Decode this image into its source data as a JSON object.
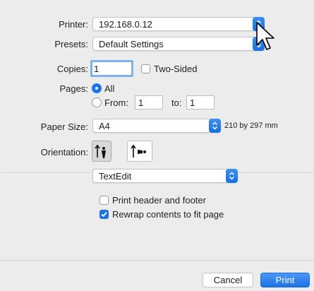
{
  "printer": {
    "label": "Printer:",
    "value": "192.168.0.12"
  },
  "presets": {
    "label": "Presets:",
    "value": "Default Settings"
  },
  "copies": {
    "label": "Copies:",
    "value": "1",
    "two_sided_label": "Two-Sided",
    "two_sided_checked": false
  },
  "pages": {
    "label": "Pages:",
    "all_label": "All",
    "from_label": "From:",
    "from_value": "1",
    "to_label": "to:",
    "to_value": "1",
    "selected": "All"
  },
  "paper_size": {
    "label": "Paper Size:",
    "value": "A4",
    "dimensions": "210 by 297 mm"
  },
  "orientation": {
    "label": "Orientation:",
    "selected": "portrait"
  },
  "app_section": {
    "value": "TextEdit"
  },
  "options": {
    "print_header_footer": {
      "label": "Print header and footer",
      "checked": false
    },
    "rewrap": {
      "label": "Rewrap contents to fit page",
      "checked": true
    }
  },
  "buttons": {
    "cancel": "Cancel",
    "print": "Print"
  },
  "colors": {
    "accent": "#1a74e8",
    "background": "#ececec"
  }
}
